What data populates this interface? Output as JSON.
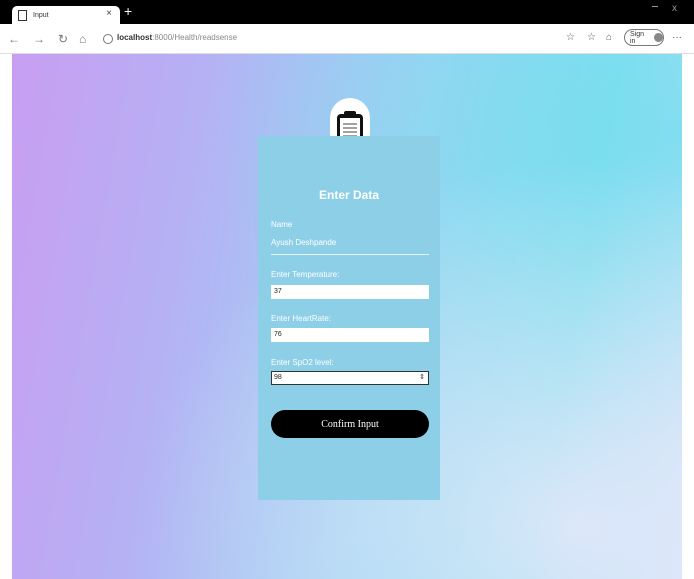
{
  "browser": {
    "tab": {
      "title": "Input",
      "close_icon": "×"
    },
    "new_tab_icon": "+",
    "window_close_icon": "x",
    "address": {
      "host": "localhost",
      "path": ":8000/Health/readsense",
      "icon": "info-icon"
    },
    "nav_icons": {
      "back": "←",
      "forward": "→",
      "refresh": "↻",
      "home": "⌂"
    },
    "toolbar_icons": {
      "favorite": "☆",
      "collections": "☆",
      "profile": "⌂",
      "more": "···"
    },
    "signin_label": "Sign in"
  },
  "colors": {
    "card": "#8ecfe8",
    "button": "#000000",
    "gradient_left": "#c89ef2",
    "gradient_right": "#7fe0ec"
  },
  "form": {
    "icon": "clipboard-icon",
    "title": "Enter Data",
    "name_label": "Name",
    "name_value": "Ayush Deshpande",
    "temperature_label": "Enter Temperature:",
    "temperature_value": "37",
    "heartrate_label": "Enter HeartRate:",
    "heartrate_value": "76",
    "spo2_label": "Enter SpO2 level:",
    "spo2_value": "98",
    "confirm_label": "Confirm Input"
  }
}
